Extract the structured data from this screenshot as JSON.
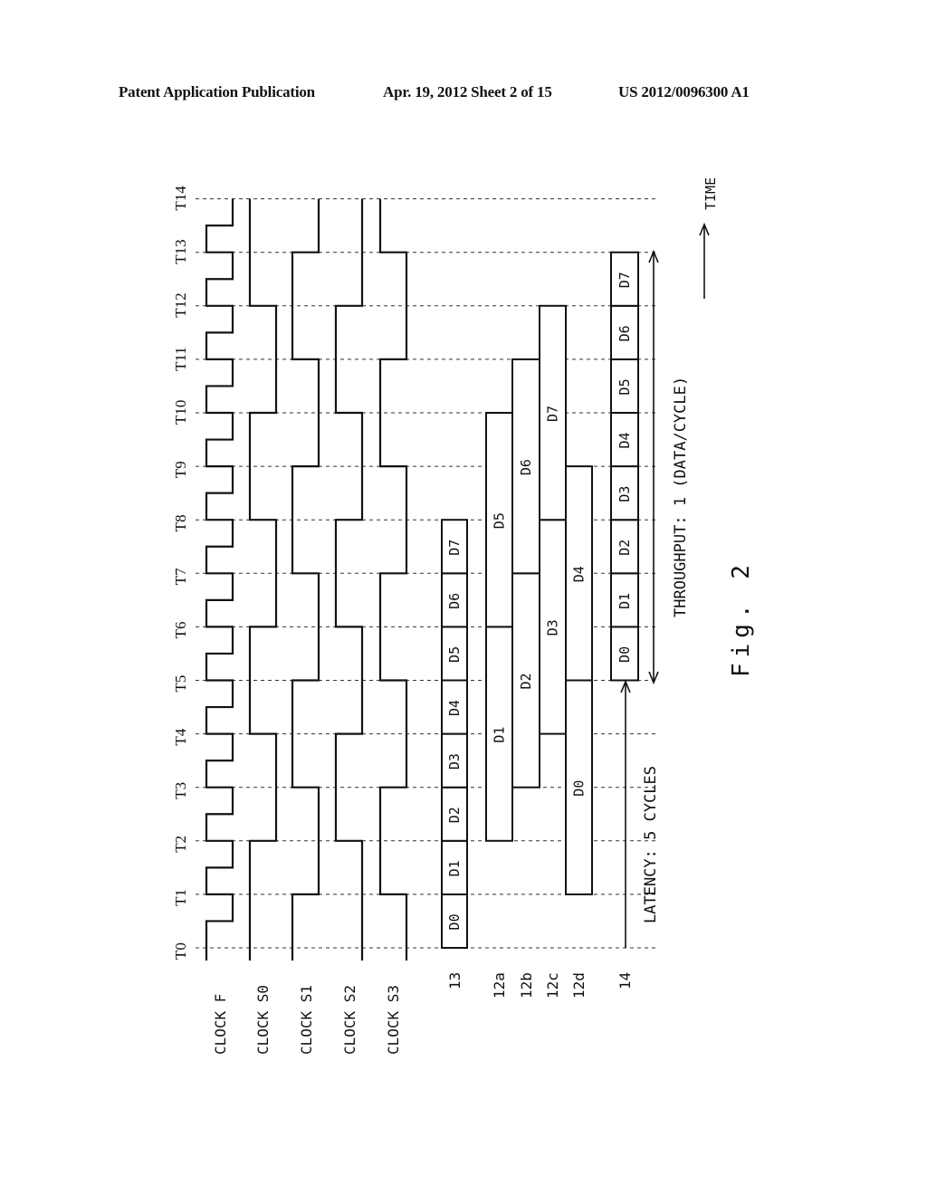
{
  "header": {
    "publication": "Patent Application Publication",
    "date_sheet": "Apr. 19, 2012  Sheet 2 of 15",
    "number": "US 2012/0096300 A1"
  },
  "figure": {
    "caption": "Fig. 2",
    "time_axis_label": "TIME",
    "time_labels": [
      "T0",
      "T1",
      "T2",
      "T3",
      "T4",
      "T5",
      "T6",
      "T7",
      "T8",
      "T9",
      "T10",
      "T11",
      "T12",
      "T13",
      "T14"
    ],
    "signals": [
      {
        "id": "clock-f",
        "label": "CLOCK F",
        "type": "clock",
        "levels": [
          1,
          0,
          1,
          0,
          1,
          0,
          1,
          0,
          1,
          0,
          1,
          0,
          1,
          0,
          1,
          0,
          1,
          0,
          1,
          0,
          1,
          0,
          1,
          0,
          1,
          0,
          1,
          0
        ],
        "step": "half-cycle"
      },
      {
        "id": "clock-s0",
        "label": "CLOCK S0",
        "type": "clock",
        "levels": [
          1,
          1,
          0,
          0,
          1,
          1,
          0,
          0,
          1,
          1,
          0,
          0,
          1,
          1
        ],
        "step": "cycle"
      },
      {
        "id": "clock-s1",
        "label": "CLOCK S1",
        "type": "clock",
        "levels": [
          1,
          0,
          0,
          1,
          1,
          0,
          0,
          1,
          1,
          0,
          0,
          1,
          1,
          0
        ],
        "step": "cycle"
      },
      {
        "id": "clock-s2",
        "label": "CLOCK S2",
        "type": "clock",
        "levels": [
          0,
          0,
          1,
          1,
          0,
          0,
          1,
          1,
          0,
          0,
          1,
          1,
          0,
          0
        ],
        "step": "cycle"
      },
      {
        "id": "clock-s3",
        "label": "CLOCK S3",
        "type": "clock",
        "levels": [
          0,
          1,
          1,
          0,
          0,
          1,
          1,
          0,
          0,
          1,
          1,
          0,
          0,
          1
        ],
        "step": "cycle"
      }
    ],
    "data_rows": [
      {
        "id": "row-13",
        "label": "13",
        "blocks": [
          {
            "name": "D0",
            "start": 0,
            "end": 1
          },
          {
            "name": "D1",
            "start": 1,
            "end": 2
          },
          {
            "name": "D2",
            "start": 2,
            "end": 3
          },
          {
            "name": "D3",
            "start": 3,
            "end": 4
          },
          {
            "name": "D4",
            "start": 4,
            "end": 5
          },
          {
            "name": "D5",
            "start": 5,
            "end": 6
          },
          {
            "name": "D6",
            "start": 6,
            "end": 7
          },
          {
            "name": "D7",
            "start": 7,
            "end": 8
          }
        ]
      },
      {
        "id": "row-12a",
        "label": "12a",
        "blocks": [
          {
            "name": "D1",
            "start": 2,
            "end": 6
          },
          {
            "name": "D5",
            "start": 6,
            "end": 10
          }
        ]
      },
      {
        "id": "row-12b",
        "label": "12b",
        "blocks": [
          {
            "name": "D2",
            "start": 3,
            "end": 7
          },
          {
            "name": "D6",
            "start": 7,
            "end": 11
          }
        ]
      },
      {
        "id": "row-12c",
        "label": "12c",
        "blocks": [
          {
            "name": "D3",
            "start": 4,
            "end": 8
          },
          {
            "name": "D7",
            "start": 8,
            "end": 12
          }
        ]
      },
      {
        "id": "row-12d",
        "label": "12d",
        "blocks": [
          {
            "name": "D0",
            "start": 1,
            "end": 5
          },
          {
            "name": "D4",
            "start": 5,
            "end": 9
          }
        ]
      },
      {
        "id": "row-14",
        "label": "14",
        "blocks": [
          {
            "name": "D0",
            "start": 5,
            "end": 6
          },
          {
            "name": "D1",
            "start": 6,
            "end": 7
          },
          {
            "name": "D2",
            "start": 7,
            "end": 8
          },
          {
            "name": "D3",
            "start": 8,
            "end": 9
          },
          {
            "name": "D4",
            "start": 9,
            "end": 10
          },
          {
            "name": "D5",
            "start": 10,
            "end": 11
          },
          {
            "name": "D6",
            "start": 11,
            "end": 12
          },
          {
            "name": "D7",
            "start": 12,
            "end": 13
          }
        ]
      }
    ],
    "annotations": {
      "latency": "LATENCY: 5 CYCLES",
      "latency_cycles": 5,
      "throughput": "THROUGHPUT: 1 (DATA/CYCLE)",
      "throughput_value": 1
    }
  }
}
